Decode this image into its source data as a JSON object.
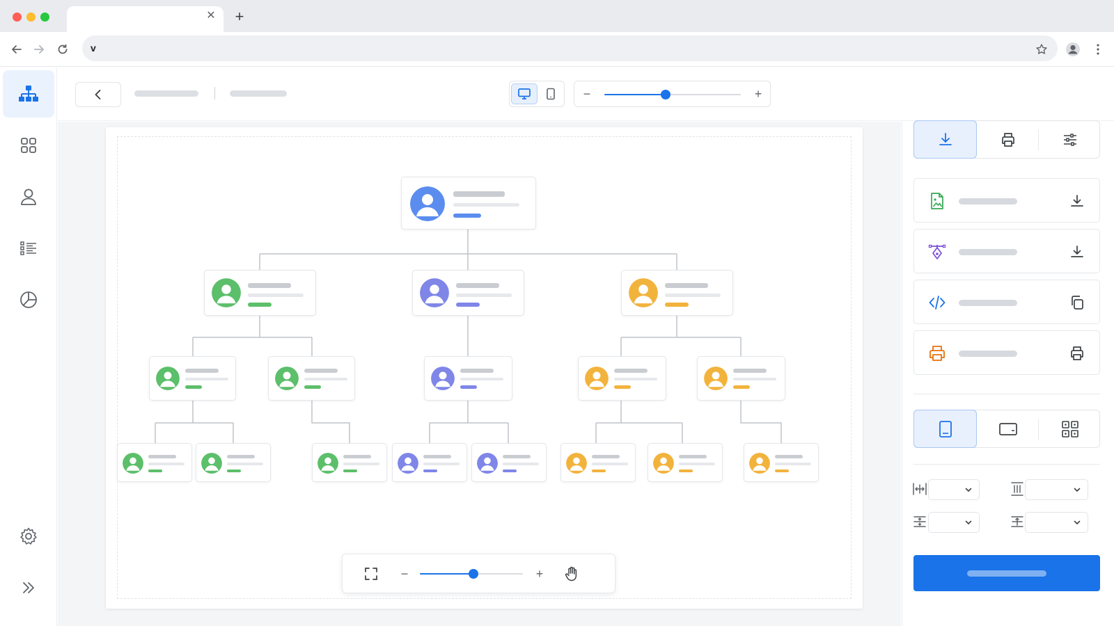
{
  "browser": {
    "window_controls": {
      "close_color": "#ff5f57",
      "minimize_color": "#febc2e",
      "maximize_color": "#28c840"
    },
    "tab": {
      "close_icon": "close-icon",
      "new_tab_icon": "plus-icon"
    },
    "address_bar": {
      "text": "v"
    },
    "icons": [
      "back-arrow-icon",
      "forward-arrow-icon",
      "reload-icon",
      "star-icon",
      "profile-icon",
      "kebab-menu-icon"
    ]
  },
  "sidebar": {
    "items": [
      {
        "icon": "org-chart-icon",
        "active": true
      },
      {
        "icon": "grid-icon",
        "active": false
      },
      {
        "icon": "user-icon",
        "active": false
      },
      {
        "icon": "list-icon",
        "active": false
      },
      {
        "icon": "pie-chart-icon",
        "active": false
      }
    ],
    "bottom_items": [
      {
        "icon": "gear-icon"
      },
      {
        "icon": "double-chevron-right-icon"
      }
    ],
    "accent": "#1a73e8"
  },
  "toolbar": {
    "back_icon": "chevron-left-icon",
    "device_toggle": {
      "options": [
        "desktop-icon",
        "tablet-icon"
      ],
      "selected": "desktop-icon"
    },
    "zoom": {
      "value": 0.45,
      "minus_icon": "minus-icon",
      "plus_icon": "plus-icon"
    }
  },
  "canvas": {
    "org_chart": {
      "branch_colors": {
        "root": "#5b8def",
        "green": "#5cbf6a",
        "purple": "#7f86e8",
        "orange": "#f2b33d"
      }
    },
    "zoom_control": {
      "value": 0.52,
      "fit_icon": "fullscreen-icon",
      "minus_label": "−",
      "plus_label": "+",
      "pan_icon": "hand-icon"
    }
  },
  "right_panel": {
    "tabs": [
      {
        "icon": "download-icon",
        "active": true
      },
      {
        "icon": "printer-icon",
        "active": false
      },
      {
        "icon": "sliders-icon",
        "active": false
      }
    ],
    "export_options": [
      {
        "icon": "image-file-icon",
        "action_icon": "download-icon",
        "color": "#34a853"
      },
      {
        "icon": "vector-pen-icon",
        "action_icon": "download-icon",
        "color": "#7b4fd6"
      },
      {
        "icon": "code-icon",
        "action_icon": "copy-icon",
        "color": "#1a73e8"
      },
      {
        "icon": "printer-icon",
        "action_icon": "printer-icon",
        "color": "#e8710a"
      }
    ],
    "layout_options": [
      {
        "icon": "portrait-page-icon",
        "active": true
      },
      {
        "icon": "landscape-page-icon",
        "active": false
      },
      {
        "icon": "grid-layout-icon",
        "active": false
      }
    ],
    "spacing_controls": [
      {
        "icon": "horizontal-spacing-icon"
      },
      {
        "icon": "vertical-spacing-icon"
      },
      {
        "icon": "row-spacing-icon"
      },
      {
        "icon": "column-spacing-icon"
      }
    ],
    "primary_button": {
      "color": "#1a73e8"
    }
  }
}
